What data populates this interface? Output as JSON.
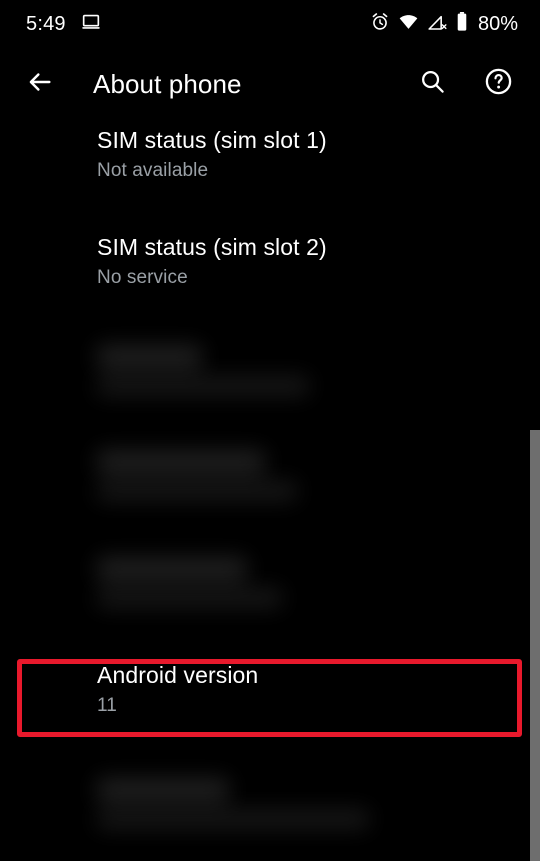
{
  "status_bar": {
    "time": "5:49",
    "cast_icon": "laptop-screen-icon",
    "alarm_icon": "alarm-clock-icon",
    "wifi_icon": "wifi-icon",
    "cellular_icon": "cellular-no-service-icon",
    "battery_icon": "battery-icon",
    "battery_percent": "80%"
  },
  "app_bar": {
    "back_icon": "back-arrow-icon",
    "title": "About phone",
    "search_icon": "search-icon",
    "help_icon": "help-circle-icon"
  },
  "list": {
    "rows": [
      {
        "title": "SIM status (sim slot 1)",
        "subtitle": "Not available"
      },
      {
        "title": "SIM status (sim slot 2)",
        "subtitle": "No service"
      },
      {
        "title": "Android version",
        "subtitle": "11"
      }
    ],
    "redacted_row_count": 4
  },
  "highlight": {
    "color": "#e8192c",
    "target": "Android version"
  },
  "scrollbar": {
    "color": "#6e6e6e"
  },
  "theme": {
    "background": "#000000",
    "primary_text": "#ffffff",
    "secondary_text": "#9aa0a6"
  }
}
